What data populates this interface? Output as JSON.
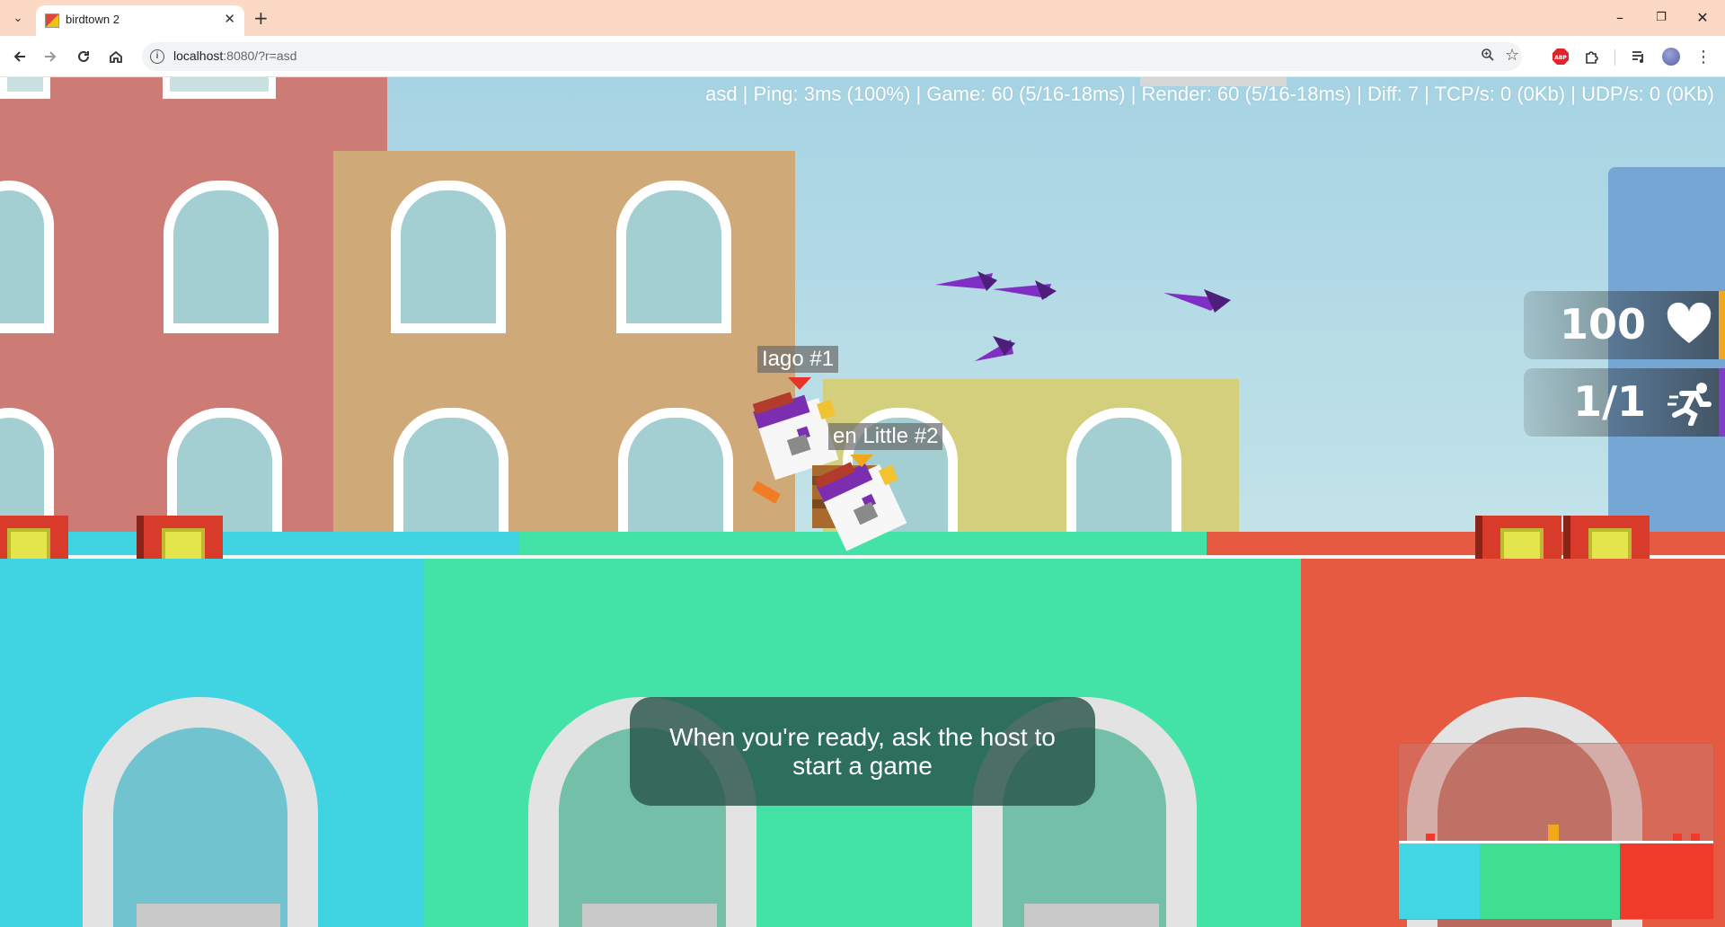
{
  "browser": {
    "tab_title": "birdtown 2",
    "url_host": "localhost",
    "url_rest": ":8080/?r=asd",
    "new_tab_symbol": "+",
    "tab_close_symbol": "✕",
    "window": {
      "minimize": "–",
      "restore": "❐",
      "close": "✕"
    },
    "icons": [
      "tab-search-icon",
      "back-icon",
      "forward-icon",
      "reload-icon",
      "home-icon",
      "site-info-icon",
      "zoom-icon",
      "bookmark-star-icon",
      "adblock-icon",
      "extensions-icon",
      "media-control-icon",
      "profile-avatar-icon",
      "menu-icon"
    ]
  },
  "game": {
    "debug_stats": "asd | Ping: 3ms (100%) | Game: 60 (5/16-18ms) | Render: 60 (5/16-18ms) | Diff: 7 | TCP/s: 0 (0Kb) | UDP/s: 0 (0Kb)",
    "players": [
      {
        "name": "Iago #1",
        "marker_color": "#e8332a"
      },
      {
        "name": "en Little #2",
        "marker_color": "#f2a81c"
      }
    ],
    "health": {
      "value": "100",
      "icon": "heart-icon",
      "accent": "#f2a81c"
    },
    "lives": {
      "value": "1/1",
      "icon": "runner-icon",
      "accent": "#7e3fc8"
    },
    "message": "When you're ready, ask the host to start a game",
    "colors": {
      "cyan": "#40d4e3",
      "green": "#43e3a8",
      "red": "#e55a40",
      "brick_red": "#cc7c75",
      "tan": "#cfaa78",
      "yellow": "#d4cf7c",
      "blue_bldg": "#75a6d4",
      "projectile": "#7f2fc4"
    }
  }
}
